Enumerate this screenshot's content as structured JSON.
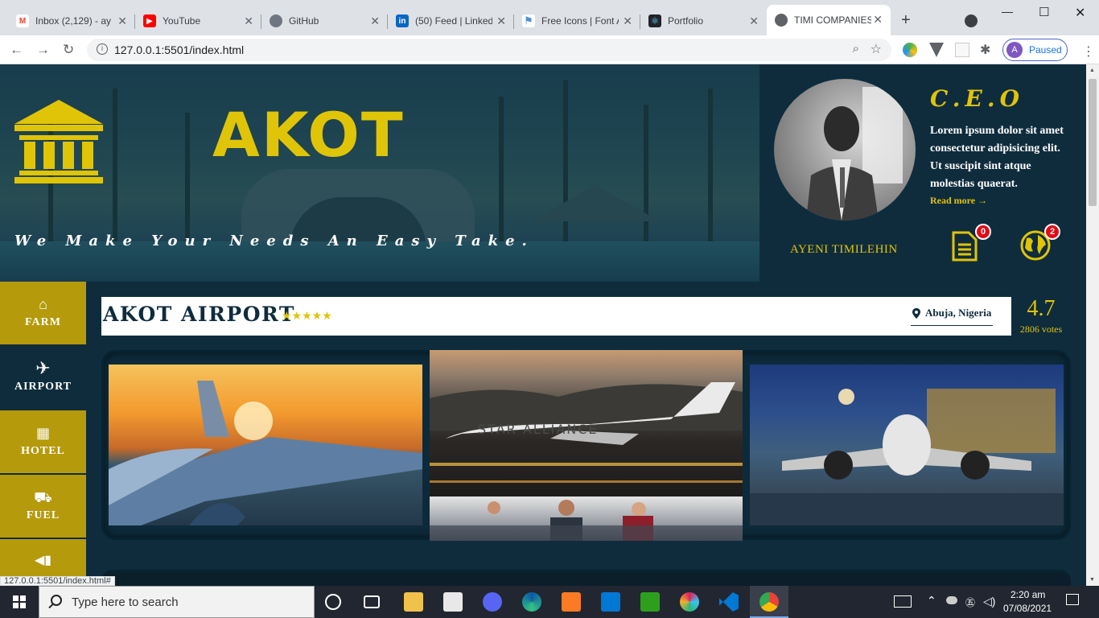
{
  "browser": {
    "tabs": [
      {
        "title": "Inbox (2,129) - ay",
        "icon": "gmail-icon",
        "color": "#ea4335",
        "glyph": "M"
      },
      {
        "title": "YouTube",
        "icon": "youtube-icon",
        "color": "#ff0000",
        "glyph": "▶"
      },
      {
        "title": "GitHub",
        "icon": "github-icon",
        "color": "#24292e",
        "glyph": "●"
      },
      {
        "title": "(50) Feed | LinkedI",
        "icon": "linkedin-icon",
        "color": "#0a66c2",
        "glyph": "in"
      },
      {
        "title": "Free Icons | Font A",
        "icon": "flag-icon",
        "color": "#538dd7",
        "glyph": "⚑"
      },
      {
        "title": "Portfolio",
        "icon": "react-icon",
        "color": "#20232a",
        "glyph": "⚛"
      },
      {
        "title": "TIMI COMPANIES",
        "icon": "globe-icon",
        "color": "#5f6368",
        "glyph": "◍"
      }
    ],
    "url": "127.0.0.1:5501/index.html",
    "profile_initial": "A",
    "profile_label": "Paused",
    "status_url": "127.0.0.1:5501/index.html#"
  },
  "hero": {
    "brand": "AKOT",
    "tagline": "We Make Your Needs An Easy Take.",
    "accent": "#e0c407"
  },
  "ceo": {
    "title": "C.E.O",
    "text": "Lorem ipsum dolor sit amet consectetur adipisicing elit. Ut suscipit sint atque molestias quaerat.",
    "read_more": "Read more →",
    "name": "AYENI TIMILEHIN",
    "notifications": [
      {
        "icon": "document-icon",
        "count": "0"
      },
      {
        "icon": "globe-icon",
        "count": "2"
      }
    ]
  },
  "sidebar": {
    "items": [
      {
        "label": "FARM",
        "icon": "home-icon",
        "glyph": "⌂"
      },
      {
        "label": "AIRPORT",
        "icon": "plane-icon",
        "glyph": "✈"
      },
      {
        "label": "HOTEL",
        "icon": "building-icon",
        "glyph": "▦"
      },
      {
        "label": "FUEL",
        "icon": "truck-icon",
        "glyph": "⛟"
      },
      {
        "label": "",
        "icon": "megaphone-icon",
        "glyph": "📣"
      }
    ]
  },
  "business": {
    "name": "AKOT AIRPORT",
    "stars": "★★★★★",
    "location": "Abuja, Nigeria",
    "rating": "4.7",
    "votes": "2806 votes"
  },
  "taskbar": {
    "search_placeholder": "Type here to search",
    "time": "2:20 am",
    "date": "07/08/2021"
  }
}
